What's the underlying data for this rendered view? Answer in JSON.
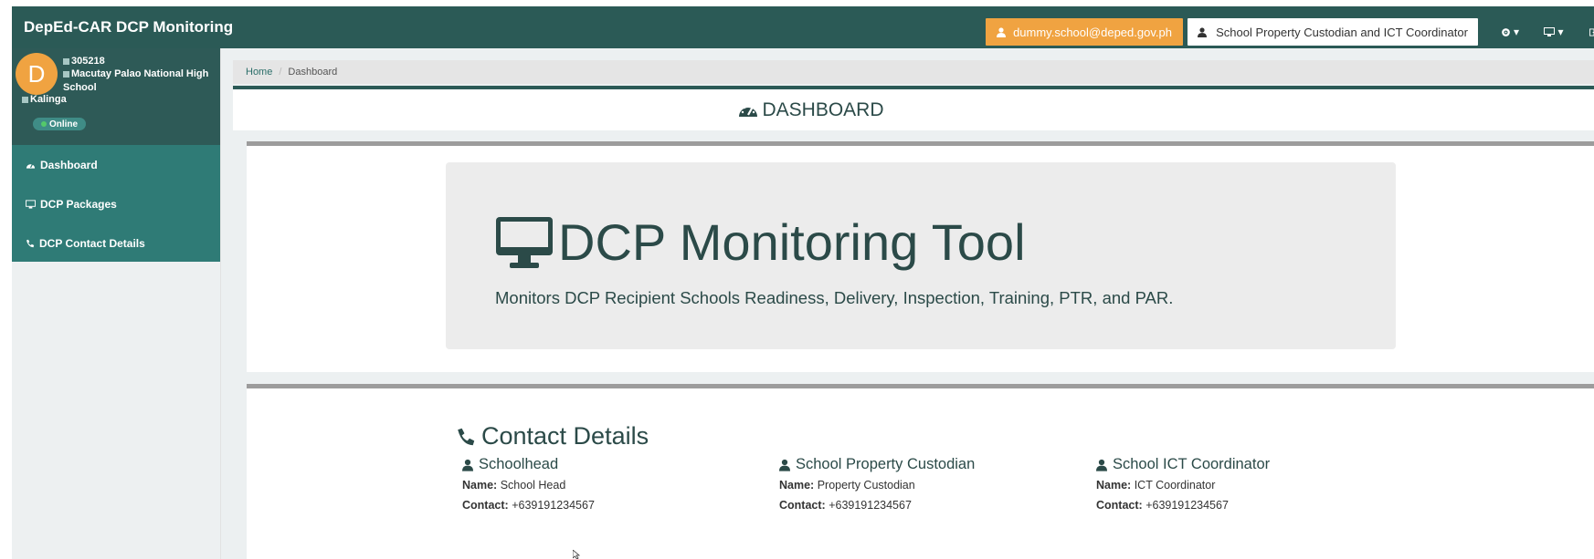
{
  "navbar": {
    "brand": "DepEd-CAR DCP Monitoring",
    "email": "dummy.school@deped.gov.ph",
    "role": "School Property Custodian and ICT Coordinator",
    "colors": {
      "navbar": "#2b5a56",
      "email_badge": "#f0a341"
    }
  },
  "sidebar": {
    "avatar_letter": "D",
    "school_id": "305218",
    "school_name_line1": "Macutay Palao National High",
    "school_name_line2": "School",
    "division": "Kalinga",
    "status": "Online",
    "menu": [
      {
        "label": "Dashboard",
        "icon": "dashboard-icon"
      },
      {
        "label": "DCP Packages",
        "icon": "monitor-icon"
      },
      {
        "label": "DCP Contact Details",
        "icon": "phone-icon"
      }
    ]
  },
  "breadcrumb": {
    "home": "Home",
    "current": "Dashboard"
  },
  "page": {
    "title": "DASHBOARD"
  },
  "jumbotron": {
    "title": "DCP Monitoring Tool",
    "subtitle": "Monitors DCP Recipient Schools Readiness, Delivery, Inspection, Training, PTR, and PAR."
  },
  "contacts": {
    "title": "Contact Details",
    "name_label": "Name:",
    "contact_label": "Contact:",
    "columns": [
      {
        "title": "Schoolhead",
        "name": "School Head",
        "contact": "+639191234567"
      },
      {
        "title": "School Property Custodian",
        "name": "Property Custodian",
        "contact": "+639191234567"
      },
      {
        "title": "School ICT Coordinator",
        "name": "ICT Coordinator",
        "contact": "+639191234567"
      }
    ]
  }
}
